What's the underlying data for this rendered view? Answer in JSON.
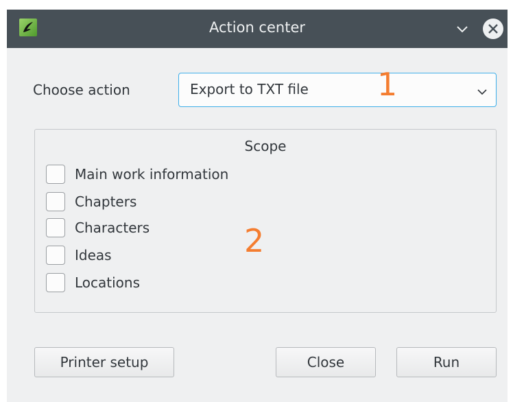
{
  "window": {
    "title": "Action center"
  },
  "titlebar": {
    "app_icon": "quill-icon",
    "minimize_icon": "chevron-down-icon",
    "close_icon": "close-icon"
  },
  "form": {
    "choose_label": "Choose action",
    "action_select": {
      "value": "Export to TXT file",
      "icon": "chevron-down-icon"
    }
  },
  "annotations": {
    "one": "1",
    "two": "2",
    "color": "#f47d30"
  },
  "scope": {
    "title": "Scope",
    "options": [
      {
        "label": "Main work information",
        "checked": false
      },
      {
        "label": "Chapters",
        "checked": false
      },
      {
        "label": "Characters",
        "checked": false
      },
      {
        "label": "Ideas",
        "checked": false
      },
      {
        "label": "Locations",
        "checked": false
      }
    ]
  },
  "buttons": {
    "printer_setup": "Printer setup",
    "close": "Close",
    "run": "Run"
  },
  "colors": {
    "titlebar": "#475057",
    "window_bg": "#eff0f1",
    "focus": "#3daee9"
  }
}
